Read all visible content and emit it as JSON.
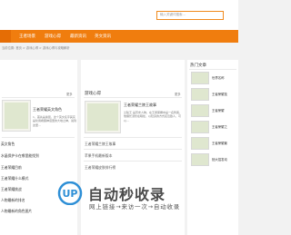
{
  "search": {
    "placeholder": "输入关键词搜索..."
  },
  "nav": {
    "items": [
      "王者场景",
      "游戏心得",
      "最新资讯",
      "英文资讯"
    ]
  },
  "breadcrumb": "当前位置: 首页 > 游戏心得 > 游戏心得与攻略解析",
  "left_panel": {
    "more": "更多",
    "featured_title": "王者荣耀英文角色",
    "featured_desc": "1、首先是奥昆，这个英文名字其实是化用希腊神话里的大地之神，说到这里...",
    "list": [
      "英文角色",
      "水晶保护卡在哪里能找到",
      "王者荣耀目前",
      "王者荣耀什么模式",
      "王者荣耀挑战",
      "人物最新的排名",
      "人物最新的角色图片"
    ]
  },
  "mid_panel": {
    "title": "游戏心得",
    "more": "更多",
    "featured_title": "王者荣耀兰陵王故事",
    "featured_desc": "兰陵王 是历史人物，在王者荣耀中是一名刺客，他擅长潜伏在暗处，以隐身的方式接近敌人，可以...",
    "list": [
      "王者荣耀兰陵王故事",
      "苹果手机最新版本",
      "王者荣耀皮肤排行榜"
    ]
  },
  "right_panel": {
    "title": "热门文章",
    "items": [
      "世界名称",
      "王者荣耀技",
      "王者荣耀",
      "王者荣耀之",
      "王者荣耀最",
      "铠大招发动"
    ]
  },
  "watermark": {
    "mark": "UP",
    "main": "自动秒收录",
    "sub": "网上链接→来访一次→自动收录"
  }
}
